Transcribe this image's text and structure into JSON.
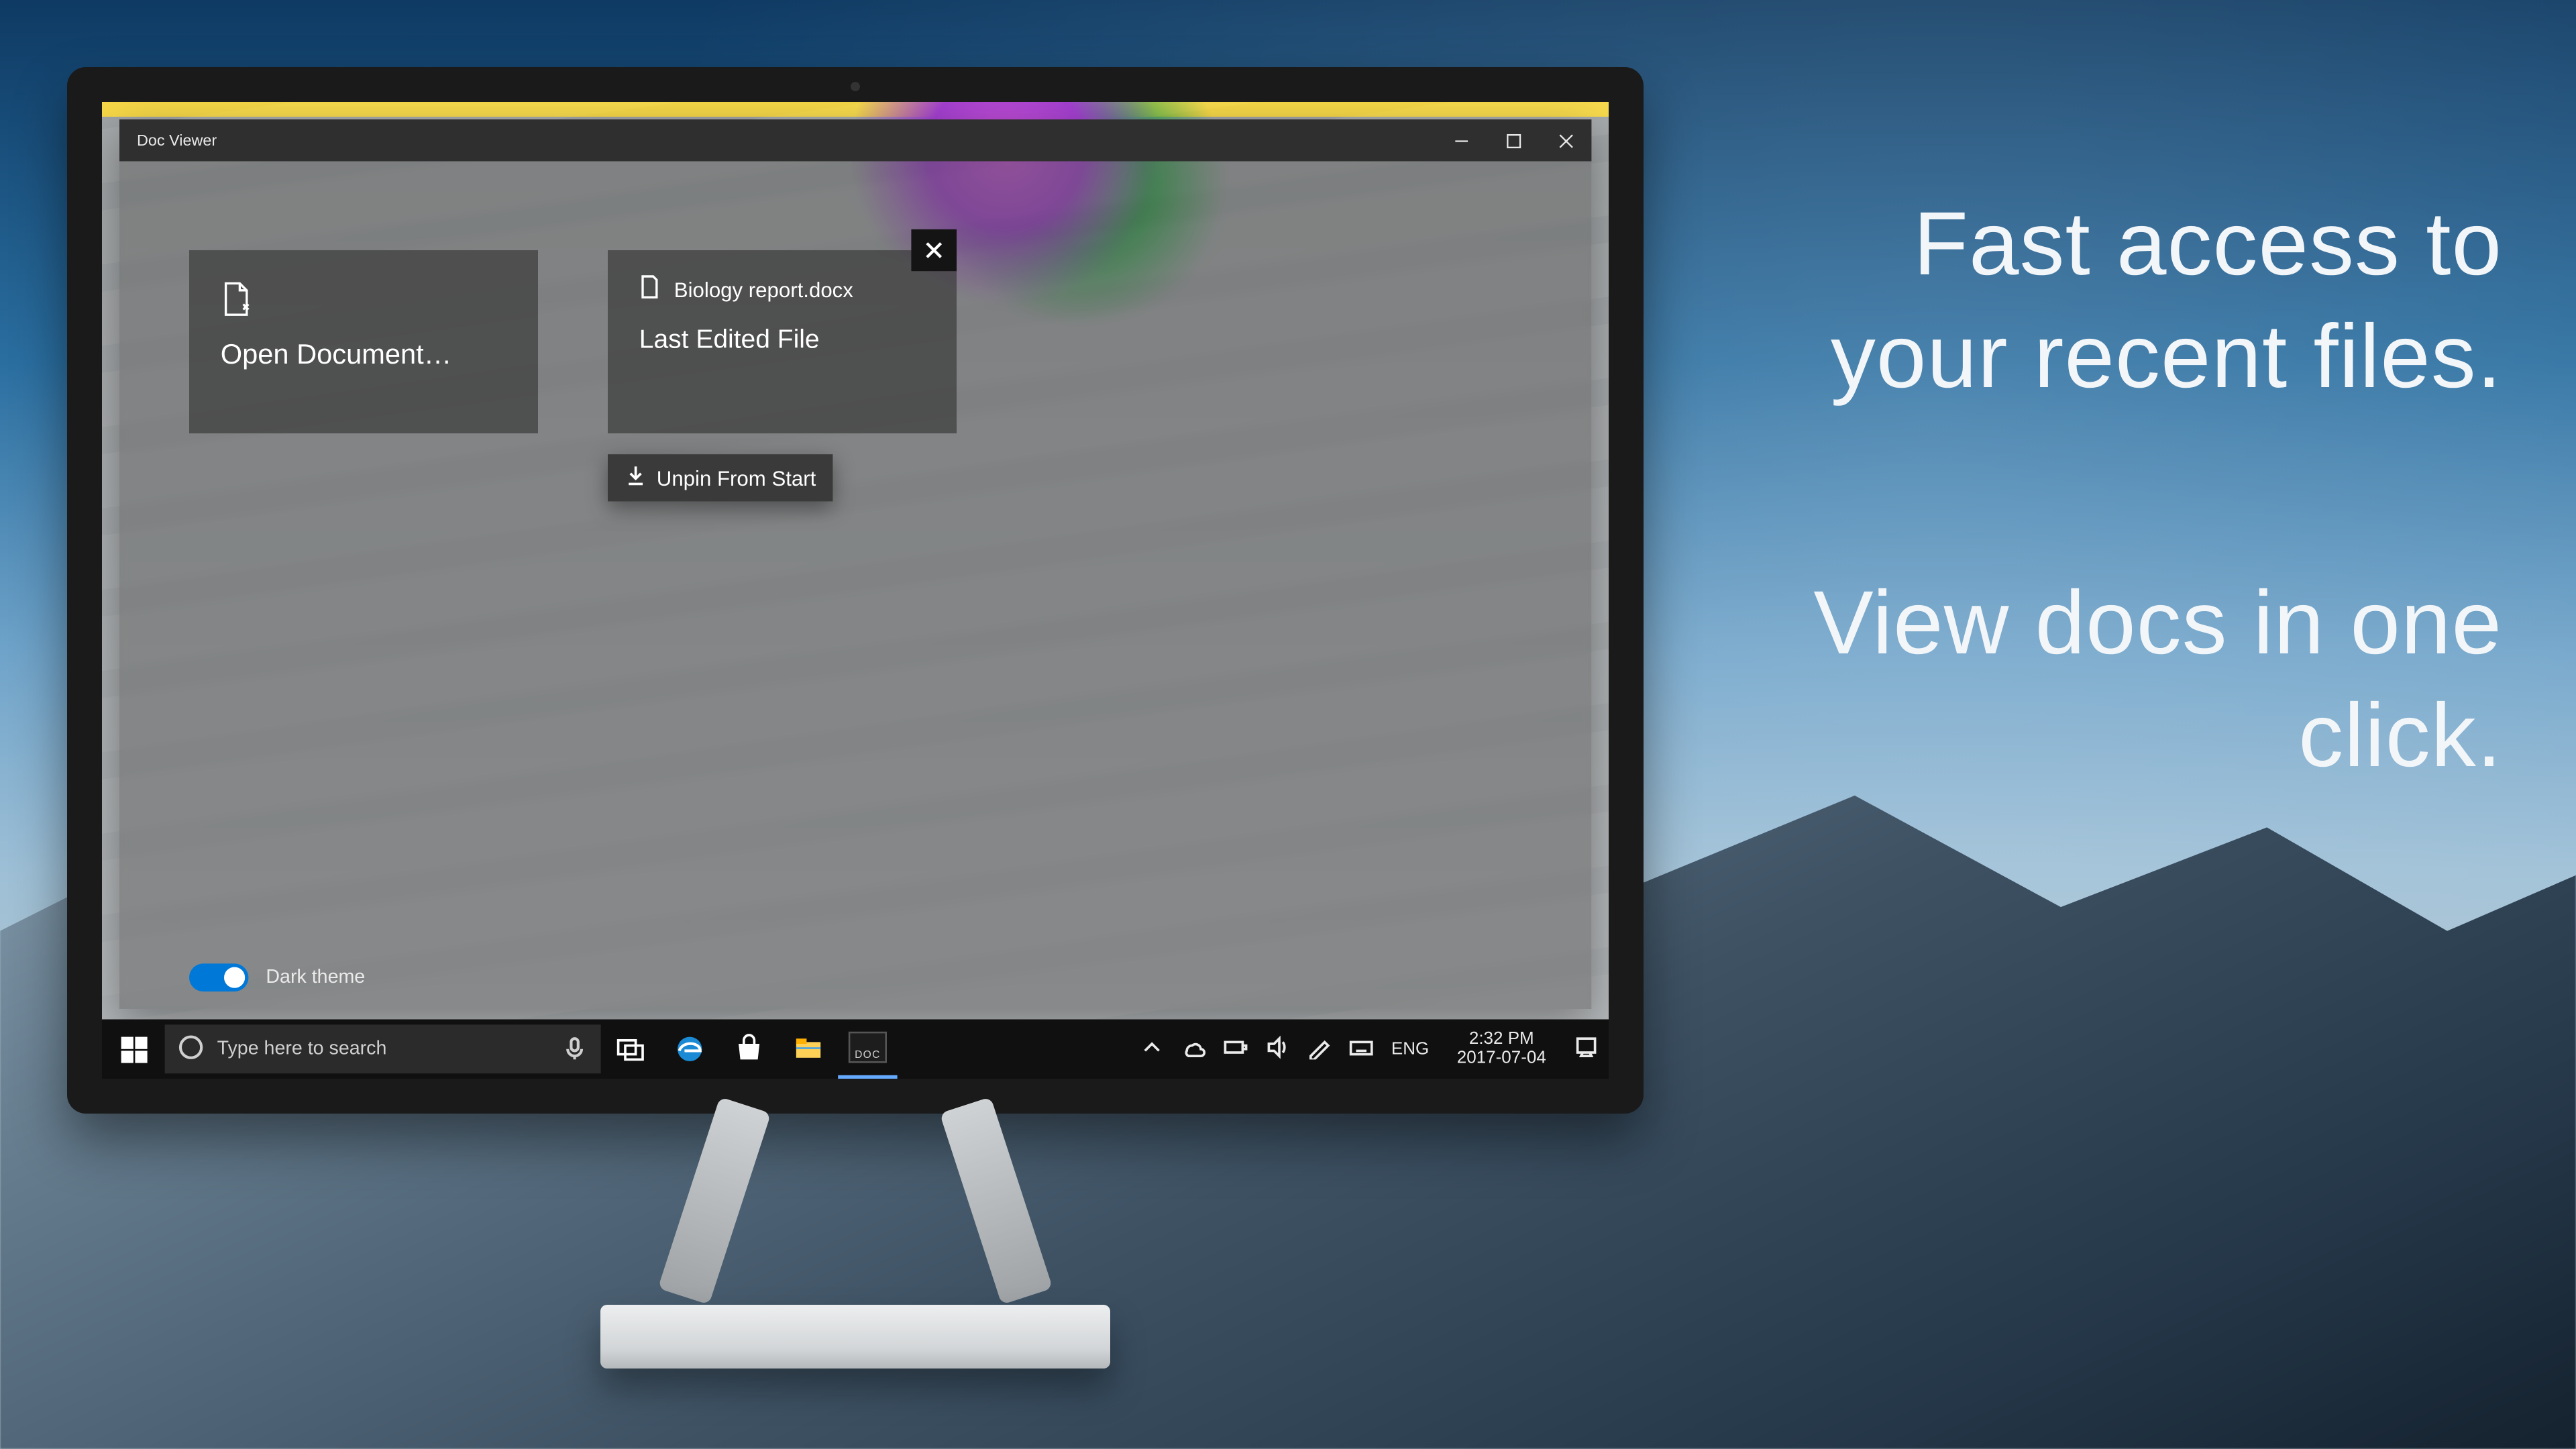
{
  "promo": {
    "line1": "Fast access to your recent files.",
    "line2": "View docs in one click."
  },
  "app": {
    "title": "Doc Viewer",
    "open_tile": {
      "label": "Open Document…"
    },
    "recent_tile": {
      "filename": "Biology report.docx",
      "subtitle": "Last Edited File"
    },
    "context_menu": {
      "unpin": "Unpin From Start"
    },
    "theme_toggle": {
      "label": "Dark theme",
      "on": true
    }
  },
  "taskbar": {
    "search_placeholder": "Type here to search",
    "lang": "ENG",
    "time": "2:32 PM",
    "date": "2017-07-04"
  }
}
